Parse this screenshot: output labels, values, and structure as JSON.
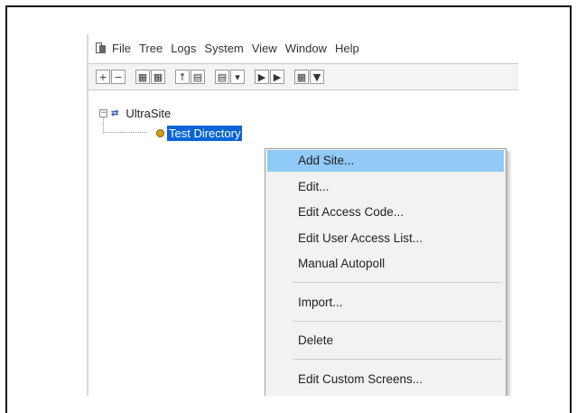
{
  "menubar": {
    "items": [
      "File",
      "Tree",
      "Logs",
      "System",
      "View",
      "Window",
      "Help"
    ]
  },
  "toolbar": {
    "groups": [
      {
        "icon": "add-remove-icons",
        "buttons": [
          "+",
          "−"
        ]
      },
      {
        "icon": "grid-icons",
        "buttons": [
          "▦",
          "▦"
        ]
      },
      {
        "icon": "upload-icons",
        "buttons": [
          "↑",
          "▤"
        ]
      },
      {
        "icon": "list-icons",
        "buttons": [
          "▤",
          "▾"
        ]
      },
      {
        "icon": "transfer-icons",
        "buttons": [
          "▶",
          "▶"
        ]
      },
      {
        "icon": "filter-icons",
        "buttons": [
          "▦",
          "▼"
        ]
      }
    ]
  },
  "tree": {
    "root": {
      "expander": "−",
      "icon": "network-icon",
      "label": "UltraSite"
    },
    "child": {
      "icon": "directory-icon",
      "label": "Test Directory"
    }
  },
  "context_menu": {
    "items": [
      {
        "label": "Add Site...",
        "highlighted": true
      },
      {
        "label": "Edit..."
      },
      {
        "label": "Edit Access Code..."
      },
      {
        "label": "Edit User Access List..."
      },
      {
        "label": "Manual Autopoll"
      },
      {
        "label": "Import..."
      },
      {
        "label": "Delete"
      },
      {
        "label": "Edit Custom Screens..."
      }
    ]
  }
}
